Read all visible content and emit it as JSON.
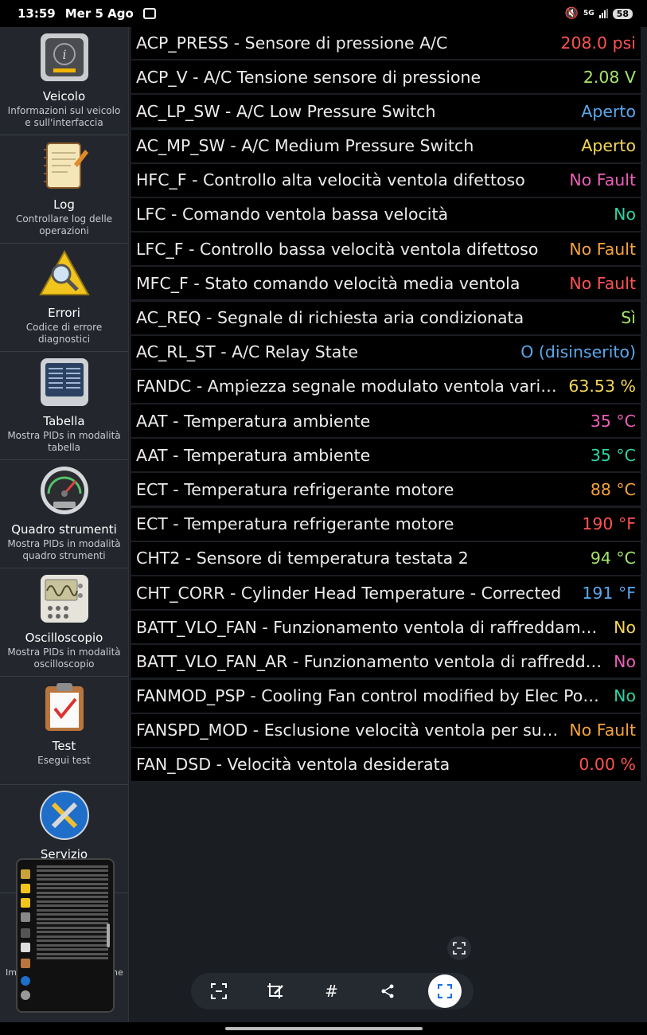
{
  "status_bar": {
    "time": "13:59",
    "date": "Mer 5 Ago",
    "network": "5G",
    "battery": "58",
    "icons": [
      "screenshot-icon",
      "mute-icon",
      "signal-icon"
    ]
  },
  "sidebar": {
    "items": [
      {
        "title": "Veicolo",
        "subtitle": "Informazioni sul veicolo e sull'interfaccia",
        "icon": "vehicle-info-icon"
      },
      {
        "title": "Log",
        "subtitle": "Controllare log delle operazioni",
        "icon": "notebook-icon"
      },
      {
        "title": "Errori",
        "subtitle": "Codice di errore diagnostici",
        "icon": "warning-magnifier-icon"
      },
      {
        "title": "Tabella",
        "subtitle": "Mostra PIDs in modalità tabella",
        "icon": "table-display-icon"
      },
      {
        "title": "Quadro strumenti",
        "subtitle": "Mostra PIDs in modalità quadro strumenti",
        "icon": "gauge-icon"
      },
      {
        "title": "Oscilloscopio",
        "subtitle": "Mostra PIDs in modalità oscilloscopio",
        "icon": "oscilloscope-icon"
      },
      {
        "title": "Test",
        "subtitle": "Esegui test",
        "icon": "clipboard-check-icon"
      },
      {
        "title": "Servizio",
        "subtitle": "",
        "icon": "tools-icon"
      }
    ],
    "partial_left": "Im",
    "partial_right": "ne"
  },
  "rows": [
    {
      "label": "ACP_PRESS - Sensore di pressione A/C",
      "value": "208.0 psi",
      "color": "#ff5252"
    },
    {
      "label": "ACP_V - A/C Tensione sensore di pressione",
      "value": "2.08 V",
      "color": "#a5e36b"
    },
    {
      "label": "AC_LP_SW - A/C Low Pressure Switch",
      "value": "Aperto",
      "color": "#5aa8ee"
    },
    {
      "label": "AC_MP_SW - A/C Medium Pressure Switch",
      "value": "Aperto",
      "color": "#f6d75a"
    },
    {
      "label": "HFC_F - Controllo alta velocità ventola difettoso",
      "value": "No Fault",
      "color": "#ec5fb8"
    },
    {
      "label": "LFC - Comando ventola bassa velocità",
      "value": "No",
      "color": "#2fd3a3"
    },
    {
      "label": "LFC_F - Controllo bassa velocità ventola difettoso",
      "value": "No Fault",
      "color": "#f6a33e"
    },
    {
      "label": "MFC_F - Stato comando velocità media ventola",
      "value": "No Fault",
      "color": "#ff5252"
    },
    {
      "label": "AC_REQ - Segnale di richiesta aria condizionata",
      "value": "Sì",
      "color": "#a5e36b"
    },
    {
      "label": "AC_RL_ST - A/C Relay State",
      "value": "O (disinserito)",
      "color": "#5aa8ee"
    },
    {
      "label": "FANDC - Ampiezza segnale modulato ventola variabile",
      "value": "63.53 %",
      "color": "#f6d75a"
    },
    {
      "label": "AAT - Temperatura ambiente",
      "value": "35 °C",
      "color": "#ec5fb8"
    },
    {
      "label": "AAT - Temperatura ambiente",
      "value": "35 °C",
      "color": "#2fd3a3"
    },
    {
      "label": "ECT - Temperatura refrigerante motore",
      "value": "88 °C",
      "color": "#f6a33e"
    },
    {
      "label": "ECT - Temperatura refrigerante motore",
      "value": "190 °F",
      "color": "#ff5252"
    },
    {
      "label": "CHT2 - Sensore di temperatura testata 2",
      "value": "94 °C",
      "color": "#a5e36b"
    },
    {
      "label": "CHT_CORR - Cylinder Head Temperature - Corrected",
      "value": "191 °F",
      "color": "#5aa8ee"
    },
    {
      "label": "BATT_VLO_FAN - Funzionamento ventola di raffreddamento…",
      "value": "No",
      "color": "#f6d75a"
    },
    {
      "label": "BATT_VLO_FAN_AR - Funzionamento ventola di raffreddam…",
      "value": "No",
      "color": "#ec5fb8"
    },
    {
      "label": "FANMOD_PSP - Cooling Fan control modified by Elec Powe…",
      "value": "No",
      "color": "#2fd3a3"
    },
    {
      "label": "FANSPD_MOD - Esclusione velocità ventola per surris…",
      "value": "No Fault",
      "color": "#f6a33e"
    },
    {
      "label": "FAN_DSD - Velocità ventola desiderata",
      "value": "0.00 %",
      "color": "#ff5252"
    }
  ],
  "toolbar": {
    "buttons": [
      "scan-text-icon",
      "edit-crop-icon",
      "hashtag-icon",
      "share-icon",
      "capture-icon"
    ]
  }
}
